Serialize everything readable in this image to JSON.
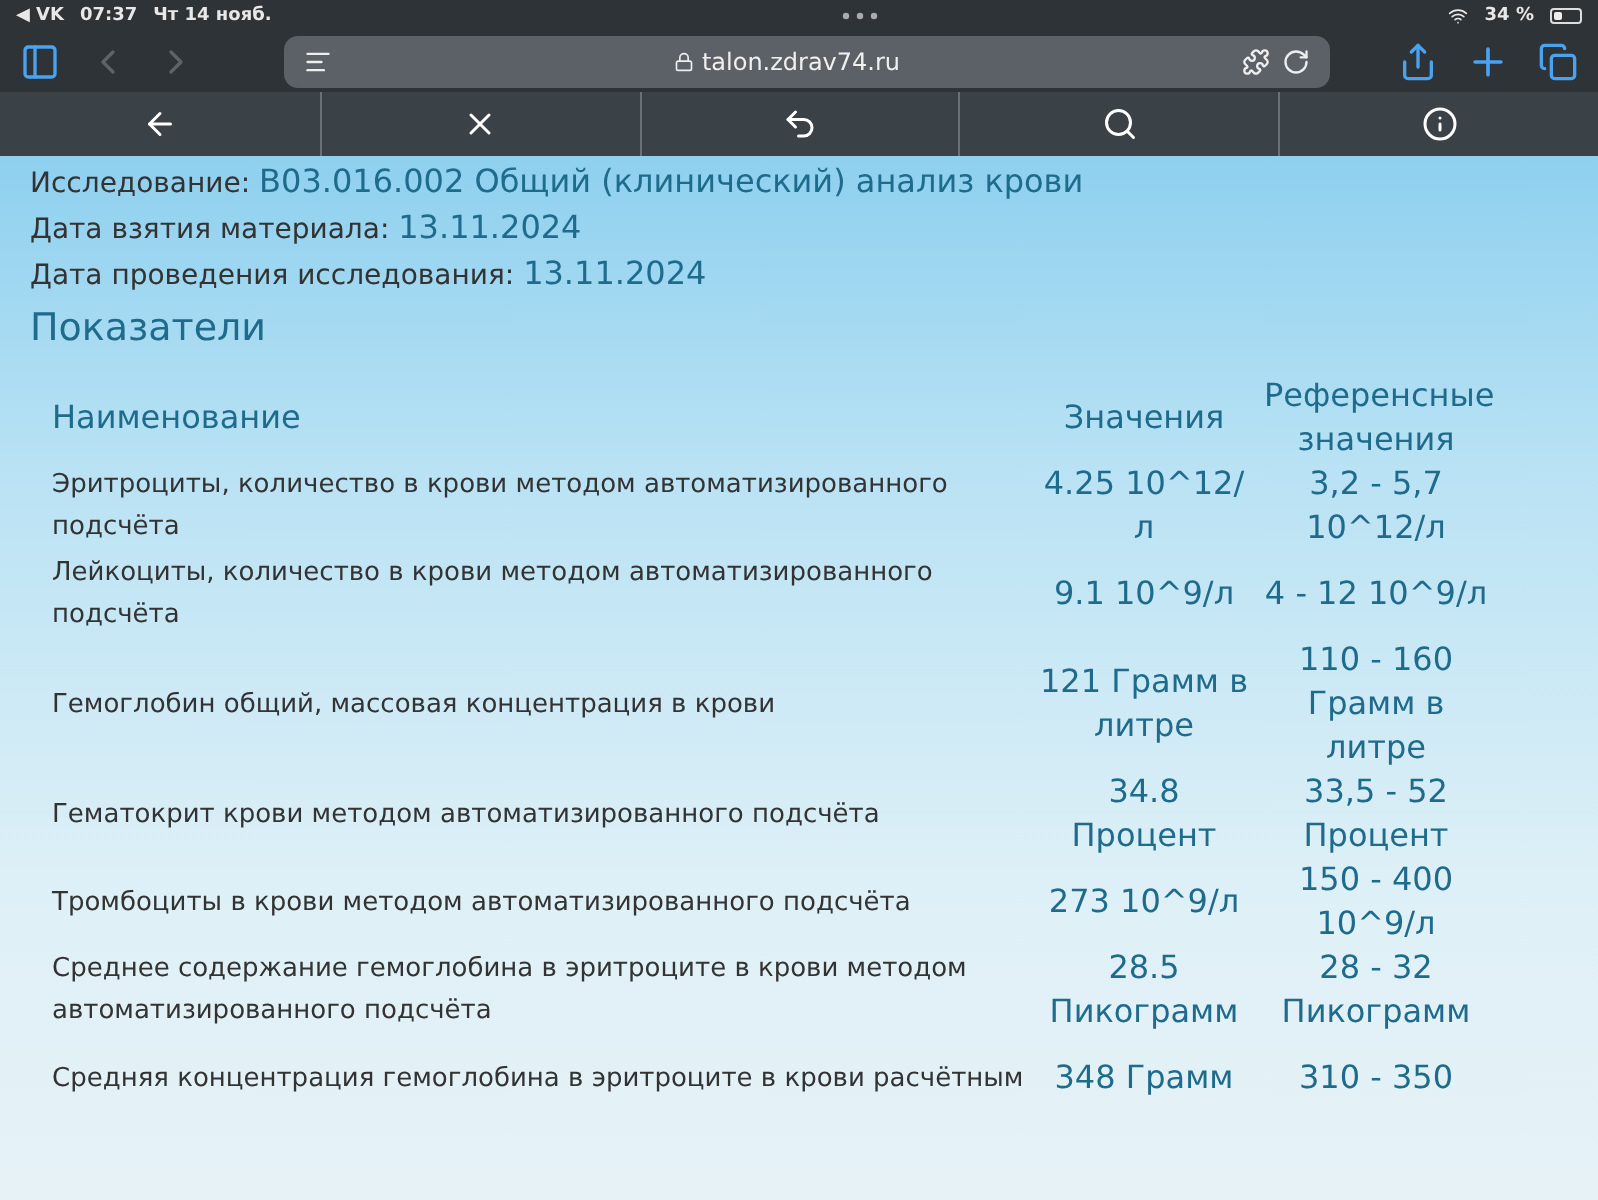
{
  "status_bar": {
    "back_app": "◀ VK",
    "time": "07:37",
    "date": "Чт 14 нояб.",
    "battery": "34 %"
  },
  "browser": {
    "url": "talon.zdrav74.ru",
    "back_disabled": true,
    "forward_disabled": true
  },
  "overlay_toolbar": [
    {
      "kind": "back"
    },
    {
      "kind": "close"
    },
    {
      "kind": "undo"
    },
    {
      "kind": "search"
    },
    {
      "kind": "info"
    }
  ],
  "fields": [
    {
      "label": "Исследование:",
      "value": "В03.016.002 Общий (клинический) анализ крови"
    },
    {
      "label": "Дата взятия материала:",
      "value": "13.11.2024"
    },
    {
      "label": "Дата проведения исследования:",
      "value": "13.11.2024"
    }
  ],
  "section_title": "Показатели",
  "table": {
    "columns": [
      "Наименование",
      "Значения",
      "Референсные значения"
    ],
    "rows": [
      {
        "name": "Эритроциты, количество в крови методом автоматизированного подсчёта",
        "value": "4.25 10^12/л",
        "reference": "3,2 - 5,7 10^12/л"
      },
      {
        "name": "Лейкоциты, количество в крови методом автоматизированного подсчёта",
        "value": "9.1 10^9/л",
        "reference": "4 - 12 10^9/л"
      },
      {
        "name": "Гемоглобин общий, массовая концентрация в крови",
        "value": "121 Грамм в литре",
        "reference": "110 - 160 Грамм в литре"
      },
      {
        "name": "Гематокрит крови методом автоматизированного подсчёта",
        "value": "34.8 Процент",
        "reference": "33,5 - 52 Процент"
      },
      {
        "name": "Тромбоциты в крови методом автоматизированного подсчёта",
        "value": "273 10^9/л",
        "reference": "150 - 400 10^9/л"
      },
      {
        "name": "Среднее содержание гемоглобина в эритроците в крови методом автоматизированного подсчёта",
        "value": "28.5 Пикограмм",
        "reference": "28 - 32 Пикограмм"
      },
      {
        "name": "Средняя концентрация гемоглобина в эритроците в крови расчётным",
        "value": "348 Грамм",
        "reference": "310 - 350"
      }
    ]
  }
}
